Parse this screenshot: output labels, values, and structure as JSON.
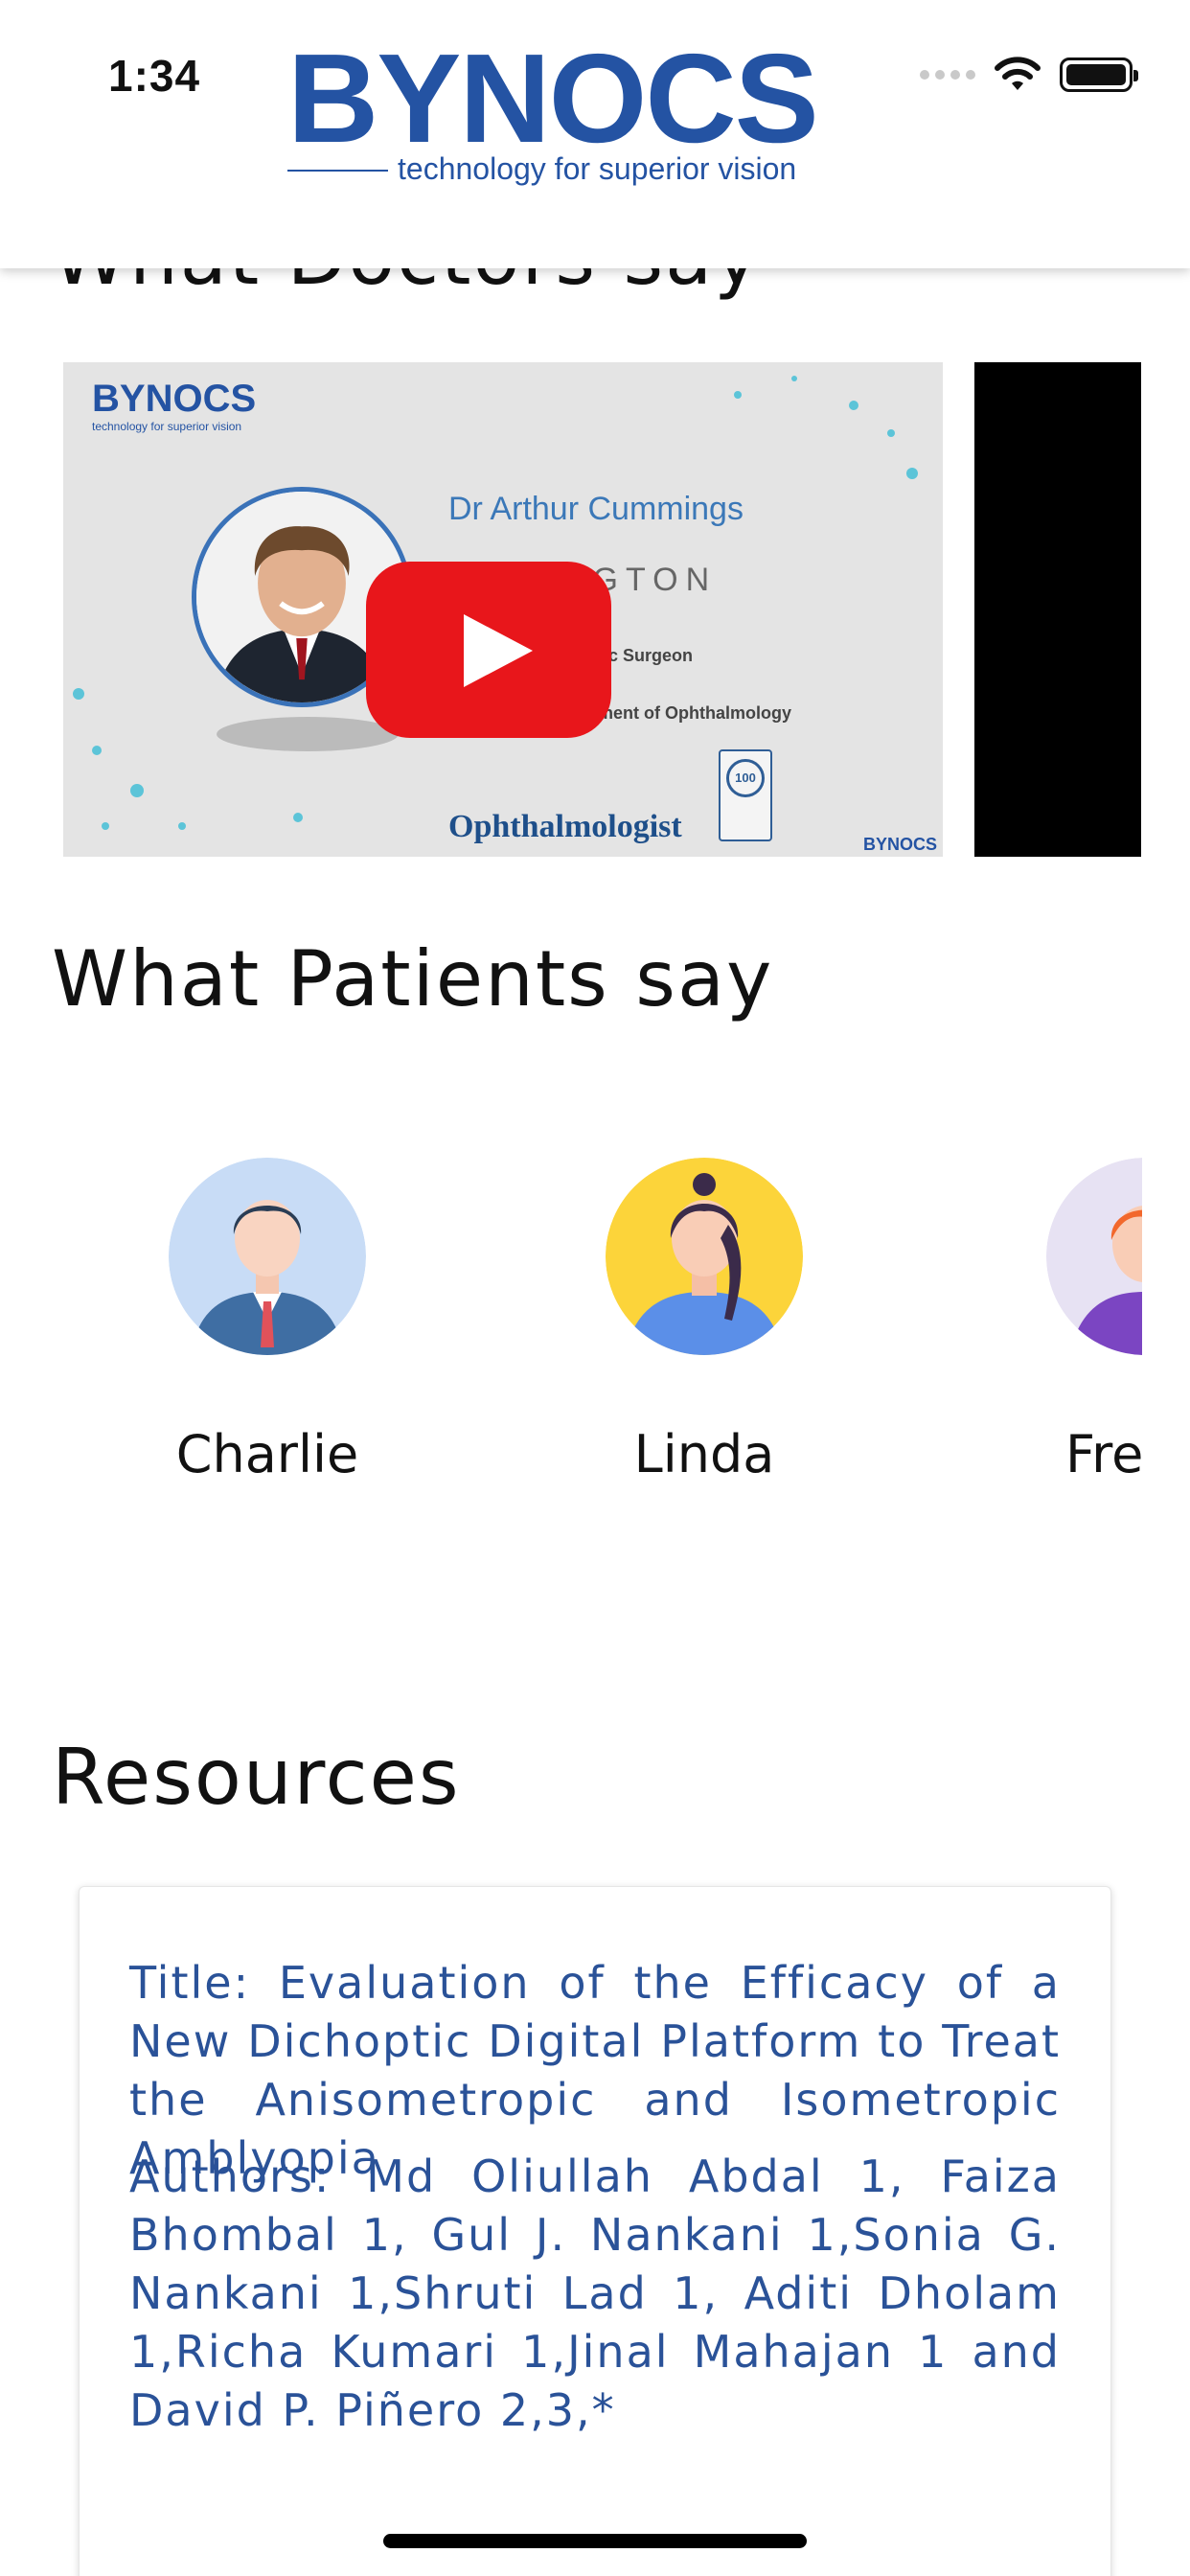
{
  "status_bar": {
    "time": "1:34"
  },
  "header": {
    "logo_text": "BYNOCS",
    "logo_tagline": "technology for superior vision"
  },
  "doctors": {
    "title": "What Doctors say",
    "video": {
      "logo": "BYNOCS",
      "logo_tagline": "technology for superior vision",
      "doctor_name": "Dr Arthur Cummings",
      "clinic": "NGTON",
      "line1": "mic Surgeon",
      "line2": "ement of Ophthalmology",
      "magazine": "Ophthalmologist",
      "seal": "100",
      "footer_logo": "BYNOCS"
    }
  },
  "patients": {
    "title": "What Patients say",
    "items": [
      {
        "name": "Charlie"
      },
      {
        "name": "Linda"
      },
      {
        "name": "Fre"
      }
    ]
  },
  "resources": {
    "title": "Resources",
    "card": {
      "title": "Title: Evaluation of the Efficacy of a New Dichoptic Digital Platform to Treat the Anisometropic and Isometropic Amblyopia",
      "authors": "Authors: Md Oliullah Abdal 1, Faiza Bhombal 1, Gul J. Nankani 1,Sonia G. Nankani 1,Shruti Lad 1, Aditi Dholam 1,Richa Kumari 1,Jinal Mahajan 1 and David P. Piñero 2,3,*"
    }
  },
  "colors": {
    "brand": "#2453a3",
    "youtube_red": "#e8161b",
    "link_text": "#2a5298"
  }
}
